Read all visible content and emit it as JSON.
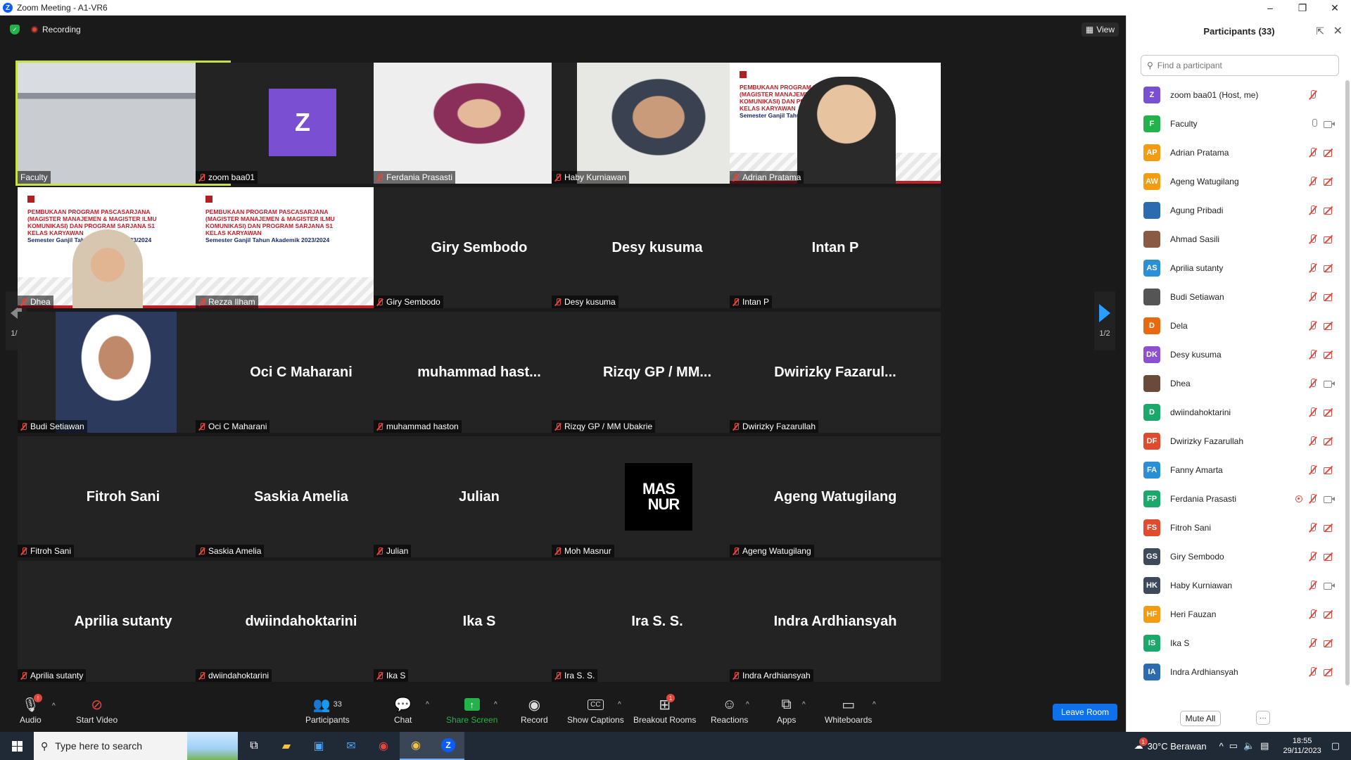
{
  "window": {
    "title": "Zoom Meeting - A1-VR6"
  },
  "topbar": {
    "recording": "Recording",
    "view": "View"
  },
  "nav": {
    "page_left": "1/2",
    "page_right": "1/2"
  },
  "tiles": [
    {
      "name": "Faculty",
      "big": "",
      "type": "video"
    },
    {
      "name": "zoom baa01",
      "big": "Z",
      "type": "avatar"
    },
    {
      "name": "Ferdania Prasasti",
      "big": "",
      "type": "video"
    },
    {
      "name": "Haby Kurniawan",
      "big": "",
      "type": "video"
    },
    {
      "name": "Adrian Pratama",
      "big": "",
      "type": "slide"
    },
    {
      "name": "Dhea",
      "big": "",
      "type": "slide"
    },
    {
      "name": "Rezza Ilham",
      "big": "",
      "type": "slide"
    },
    {
      "name": "Giry Sembodo",
      "big": "Giry Sembodo",
      "type": "name"
    },
    {
      "name": "Desy kusuma",
      "big": "Desy kusuma",
      "type": "name"
    },
    {
      "name": "Intan P",
      "big": "Intan P",
      "type": "name"
    },
    {
      "name": "Budi Setiawan",
      "big": "",
      "type": "photo"
    },
    {
      "name": "Oci C Maharani",
      "big": "Oci C Maharani",
      "type": "name"
    },
    {
      "name": "muhammad haston",
      "big": "muhammad  hast...",
      "type": "name"
    },
    {
      "name": "Rizqy GP / MM Ubakrie",
      "big": "Rizqy GP / MM...",
      "type": "name"
    },
    {
      "name": "Dwirizky Fazarullah",
      "big": "Dwirizky  Fazarul...",
      "type": "name"
    },
    {
      "name": "Fitroh Sani",
      "big": "Fitroh Sani",
      "type": "name"
    },
    {
      "name": "Saskia Amelia",
      "big": "Saskia Amelia",
      "type": "name"
    },
    {
      "name": "Julian",
      "big": "Julian",
      "type": "name"
    },
    {
      "name": "Moh Masnur",
      "big": "",
      "type": "logo"
    },
    {
      "name": "Ageng Watugilang",
      "big": "Ageng Watugilang",
      "type": "name"
    },
    {
      "name": "Aprilia sutanty",
      "big": "Aprilia sutanty",
      "type": "name"
    },
    {
      "name": "dwiindahoktarini",
      "big": "dwiindahoktarini",
      "type": "name"
    },
    {
      "name": "Ika S",
      "big": "Ika S",
      "type": "name"
    },
    {
      "name": "Ira S. S.",
      "big": "Ira S. S.",
      "type": "name"
    },
    {
      "name": "Indra Ardhiansyah",
      "big": "Indra Ardhiansyah",
      "type": "name"
    }
  ],
  "slide": {
    "lines": [
      "PEMBUKAAN PROGRAM PASCASARJANA",
      "(MAGISTER MANAJEMEN & MAGISTER ILMU",
      "KOMUNIKASI) DAN PROGRAM SARJANA S1",
      "KELAS KARYAWAN",
      "Semester Ganjil Tahun Akademik 2023/2024"
    ]
  },
  "logo": {
    "line1": "MAS",
    "line2": "NUR"
  },
  "controls": {
    "audio": "Audio",
    "start_video": "Start Video",
    "participants": "Participants",
    "participants_count": "33",
    "chat": "Chat",
    "share_screen": "Share Screen",
    "record": "Record",
    "show_captions": "Show Captions",
    "cc": "CC",
    "breakout_rooms": "Breakout Rooms",
    "breakout_badge": "1",
    "reactions": "Reactions",
    "apps": "Apps",
    "whiteboards": "Whiteboards",
    "leave_room": "Leave Room",
    "audio_badge": "!"
  },
  "panel": {
    "title": "Participants (33)",
    "search_placeholder": "Find a participant",
    "mute_all": "Mute All",
    "more": "···",
    "participants": [
      {
        "initials": "Z",
        "name": "zoom baa01 (Host, me)",
        "color": "#7b4fd1",
        "mic": "off",
        "cam": "none"
      },
      {
        "initials": "F",
        "name": "Faculty",
        "color": "#23b34a",
        "mic": "on",
        "cam": "on"
      },
      {
        "initials": "AP",
        "name": "Adrian Pratama",
        "color": "#f39c12",
        "mic": "off",
        "cam": "off"
      },
      {
        "initials": "AW",
        "name": "Ageng Watugilang",
        "color": "#f39c12",
        "mic": "off",
        "cam": "off"
      },
      {
        "initials": "",
        "name": "Agung Pribadi",
        "color": "#2b6cb0",
        "mic": "off",
        "cam": "off"
      },
      {
        "initials": "",
        "name": "Ahmad Sasili",
        "color": "#8a5a44",
        "mic": "off",
        "cam": "off"
      },
      {
        "initials": "AS",
        "name": "Aprilia sutanty",
        "color": "#2b8fd6",
        "mic": "off",
        "cam": "off"
      },
      {
        "initials": "",
        "name": "Budi Setiawan",
        "color": "#555555",
        "mic": "off",
        "cam": "off"
      },
      {
        "initials": "D",
        "name": "Dela",
        "color": "#e86a10",
        "mic": "off",
        "cam": "off"
      },
      {
        "initials": "DK",
        "name": "Desy kusuma",
        "color": "#8e4fd1",
        "mic": "off",
        "cam": "off"
      },
      {
        "initials": "",
        "name": "Dhea",
        "color": "#6a4a3a",
        "mic": "off",
        "cam": "on"
      },
      {
        "initials": "D",
        "name": "dwiindahoktarini",
        "color": "#1aa96a",
        "mic": "off",
        "cam": "off"
      },
      {
        "initials": "DF",
        "name": "Dwirizky Fazarullah",
        "color": "#e04a2f",
        "mic": "off",
        "cam": "off"
      },
      {
        "initials": "FA",
        "name": "Fanny Amarta",
        "color": "#2b8fd6",
        "mic": "off",
        "cam": "off"
      },
      {
        "initials": "FP",
        "name": "Ferdania Prasasti",
        "color": "#1aa96a",
        "mic": "off",
        "cam": "on",
        "rec": true
      },
      {
        "initials": "FS",
        "name": "Fitroh Sani",
        "color": "#e04a2f",
        "mic": "off",
        "cam": "off"
      },
      {
        "initials": "GS",
        "name": "Giry Sembodo",
        "color": "#3c4a5c",
        "mic": "off",
        "cam": "off"
      },
      {
        "initials": "HK",
        "name": "Haby Kurniawan",
        "color": "#3c4a5c",
        "mic": "off",
        "cam": "on"
      },
      {
        "initials": "HF",
        "name": "Heri Fauzan",
        "color": "#f39c12",
        "mic": "off",
        "cam": "off"
      },
      {
        "initials": "IS",
        "name": "Ika S",
        "color": "#1aa96a",
        "mic": "off",
        "cam": "off"
      },
      {
        "initials": "IA",
        "name": "Indra Ardhiansyah",
        "color": "#2b6cb0",
        "mic": "off",
        "cam": "off"
      }
    ]
  },
  "taskbar": {
    "search_placeholder": "Type here to search",
    "weather": "30°C  Berawan",
    "time": "18:55",
    "date": "29/11/2023",
    "notif_badge": "1"
  },
  "colors": {
    "zoom_blue": "#0b5cff",
    "tile_bg": "#232323",
    "muted_red": "#e5463c",
    "share_green": "#23b34a"
  }
}
